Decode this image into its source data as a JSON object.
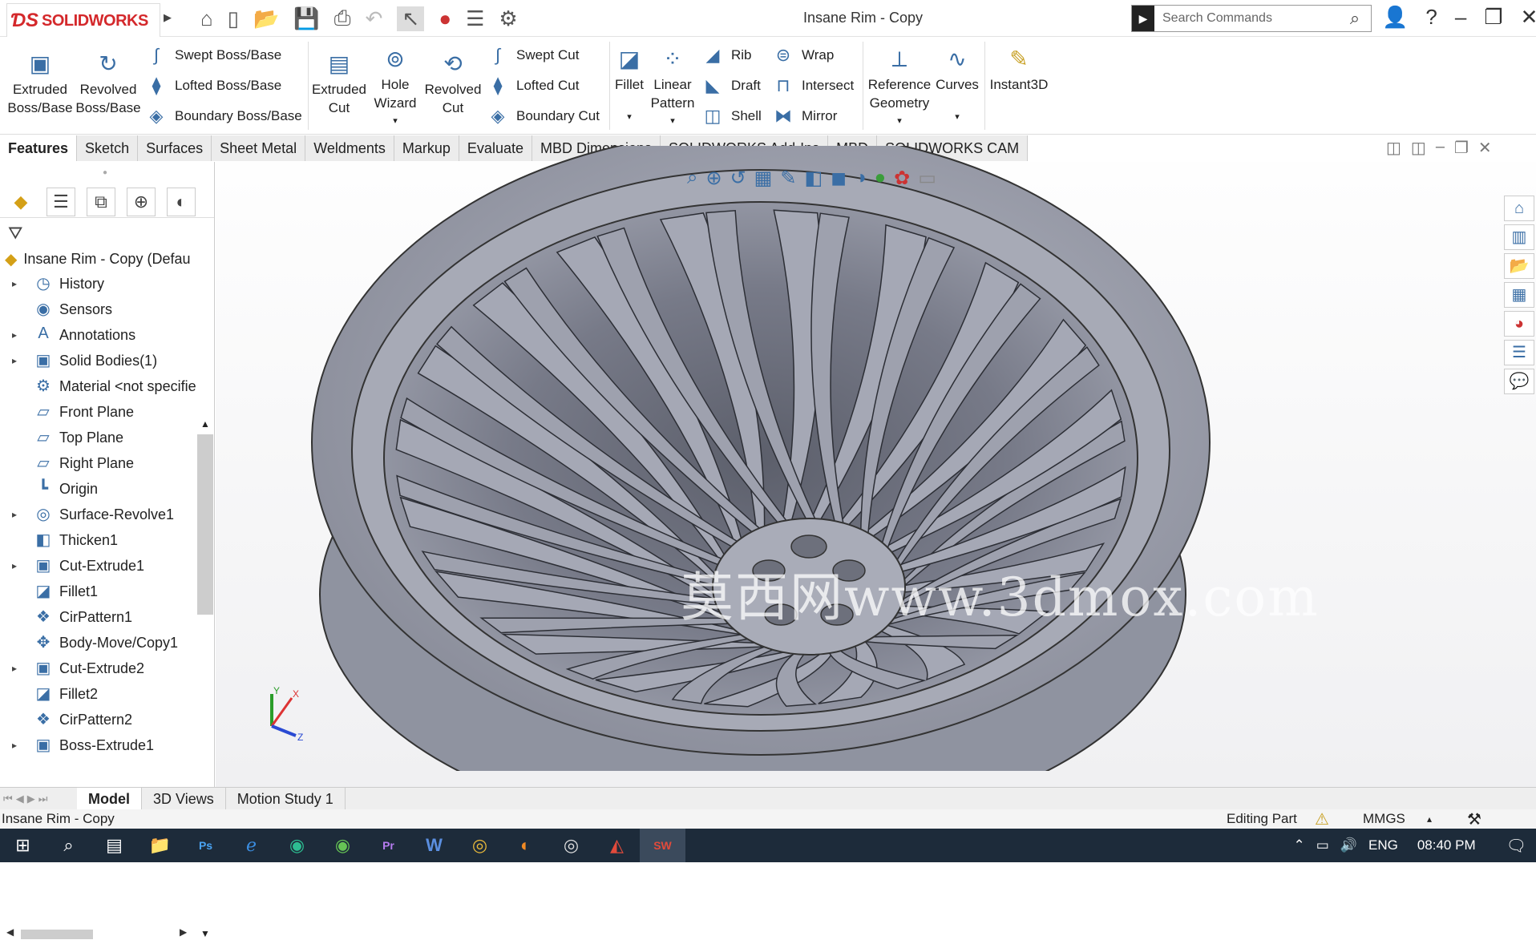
{
  "app": {
    "brand": "SOLIDWORKS",
    "title": "Insane Rim - Copy",
    "search_placeholder": "Search Commands"
  },
  "ribbon": {
    "extruded_boss": "Extruded Boss/Base",
    "revolved_boss": "Revolved Boss/Base",
    "swept_boss": "Swept Boss/Base",
    "lofted_boss": "Lofted Boss/Base",
    "boundary_boss": "Boundary Boss/Base",
    "extruded_cut": "Extruded Cut",
    "hole_wizard": "Hole Wizard",
    "revolved_cut": "Revolved Cut",
    "swept_cut": "Swept Cut",
    "lofted_cut": "Lofted Cut",
    "boundary_cut": "Boundary Cut",
    "fillet": "Fillet",
    "linear_pattern": "Linear Pattern",
    "rib": "Rib",
    "draft": "Draft",
    "shell": "Shell",
    "wrap": "Wrap",
    "intersect": "Intersect",
    "mirror": "Mirror",
    "reference_geometry": "Reference Geometry",
    "curves": "Curves",
    "instant3d": "Instant3D"
  },
  "tabs": [
    "Features",
    "Sketch",
    "Surfaces",
    "Sheet Metal",
    "Weldments",
    "Markup",
    "Evaluate",
    "MBD Dimensions",
    "SOLIDWORKS Add-Ins",
    "MBD",
    "SOLIDWORKS CAM"
  ],
  "tree": {
    "root": "Insane Rim - Copy  (Defau",
    "items": [
      {
        "label": "History",
        "expand": "▸",
        "icon": "◷"
      },
      {
        "label": "Sensors",
        "expand": "",
        "icon": "◉"
      },
      {
        "label": "Annotations",
        "expand": "▸",
        "icon": "A"
      },
      {
        "label": "Solid Bodies(1)",
        "expand": "▸",
        "icon": "▣"
      },
      {
        "label": "Material <not specifie",
        "expand": "",
        "icon": "⚙"
      },
      {
        "label": "Front Plane",
        "expand": "",
        "icon": "▱"
      },
      {
        "label": "Top Plane",
        "expand": "",
        "icon": "▱"
      },
      {
        "label": "Right Plane",
        "expand": "",
        "icon": "▱"
      },
      {
        "label": "Origin",
        "expand": "",
        "icon": "┗"
      },
      {
        "label": "Surface-Revolve1",
        "expand": "▸",
        "icon": "◎"
      },
      {
        "label": "Thicken1",
        "expand": "",
        "icon": "◧"
      },
      {
        "label": "Cut-Extrude1",
        "expand": "▸",
        "icon": "▣"
      },
      {
        "label": "Fillet1",
        "expand": "",
        "icon": "◪"
      },
      {
        "label": "CirPattern1",
        "expand": "",
        "icon": "❖"
      },
      {
        "label": "Body-Move/Copy1",
        "expand": "",
        "icon": "✥"
      },
      {
        "label": "Cut-Extrude2",
        "expand": "▸",
        "icon": "▣"
      },
      {
        "label": "Fillet2",
        "expand": "",
        "icon": "◪"
      },
      {
        "label": "CirPattern2",
        "expand": "",
        "icon": "❖"
      },
      {
        "label": "Boss-Extrude1",
        "expand": "▸",
        "icon": "▣"
      }
    ]
  },
  "watermark": "莫西网www.3dmox.com",
  "bottom_tabs": [
    "Model",
    "3D Views",
    "Motion Study 1"
  ],
  "status": {
    "left": "Insane Rim - Copy",
    "mode": "Editing Part",
    "units": "MMGS"
  },
  "taskbar": {
    "lang": "ENG",
    "time": "08:40 PM"
  }
}
